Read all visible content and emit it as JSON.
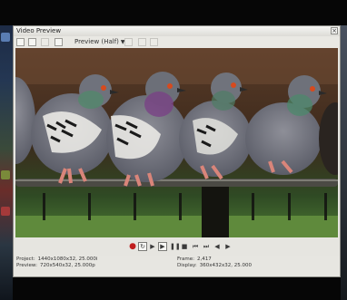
{
  "window": {
    "title": "Video Preview",
    "close_glyph": "×"
  },
  "toolbar": {
    "preview_quality": "Preview (Half)",
    "buttons": [
      {
        "name": "video-output-icon"
      },
      {
        "name": "split-screen-icon"
      },
      {
        "name": "overlays-icon"
      },
      {
        "name": "adjust-size-icon"
      },
      {
        "name": "copy-snapshot-icon"
      },
      {
        "name": "save-snapshot-icon"
      }
    ]
  },
  "transport": {
    "controls": [
      {
        "name": "record-icon",
        "glyph": "●"
      },
      {
        "name": "loop-playback-icon",
        "glyph": "↻"
      },
      {
        "name": "play-from-start-icon",
        "glyph": "▶"
      },
      {
        "name": "play-icon",
        "glyph": "▶"
      },
      {
        "name": "pause-icon",
        "glyph": "❚❚"
      },
      {
        "name": "stop-icon",
        "glyph": "■"
      },
      {
        "name": "go-to-start-icon",
        "glyph": "⏮"
      },
      {
        "name": "go-to-end-icon",
        "glyph": "⏭"
      },
      {
        "name": "previous-frame-icon",
        "glyph": "◀"
      },
      {
        "name": "next-frame-icon",
        "glyph": "▶"
      }
    ]
  },
  "info": {
    "project_label": "Project:",
    "project_value": "1440x1080x32, 25.000i",
    "preview_label": "Preview:",
    "preview_value": "720x540x32, 25.000p",
    "frame_label": "Frame:",
    "frame_value": "2,417",
    "display_label": "Display:",
    "display_value": "360x432x32, 25.000"
  },
  "colors": {
    "record": "#c01e1e",
    "window_bg": "#e7e6e1"
  }
}
